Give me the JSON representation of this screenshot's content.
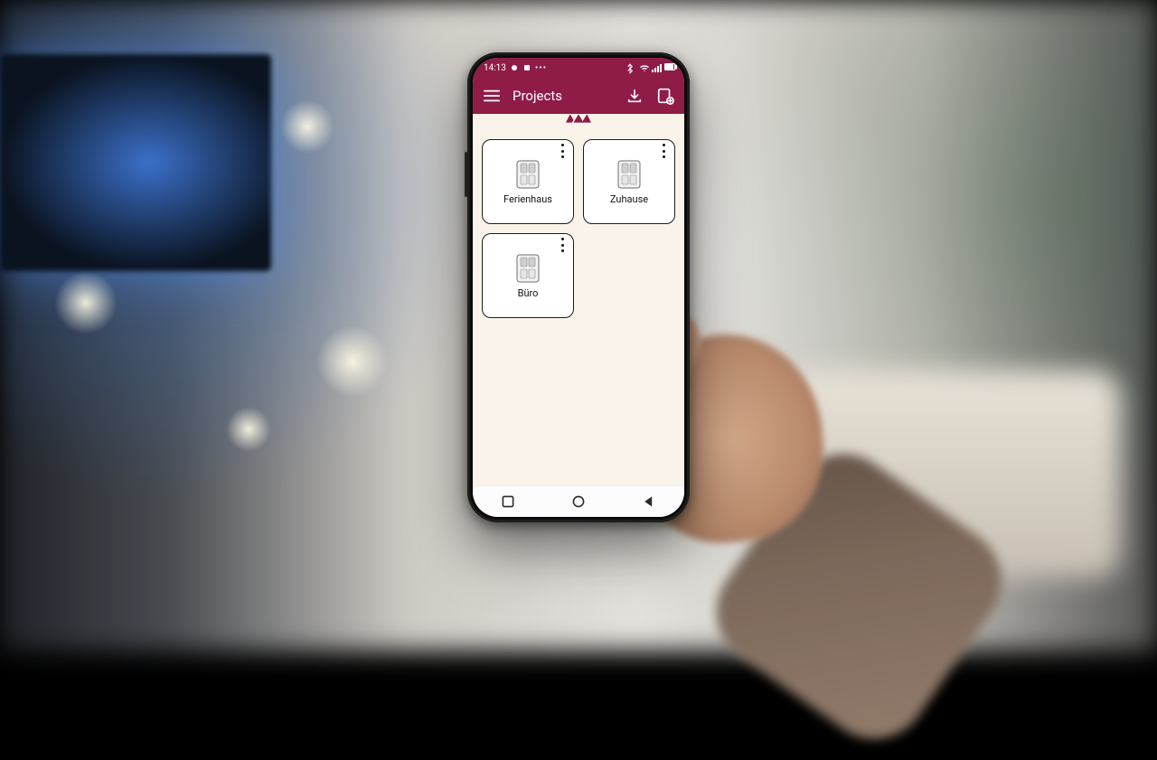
{
  "statusbar": {
    "time": "14:13",
    "right_text": ""
  },
  "appbar": {
    "title": "Projects"
  },
  "projects": [
    {
      "label": "Ferienhaus"
    },
    {
      "label": "Zuhause"
    },
    {
      "label": "Büro"
    }
  ],
  "colors": {
    "brand": "#8f1c47",
    "surface": "#faf3e9"
  }
}
